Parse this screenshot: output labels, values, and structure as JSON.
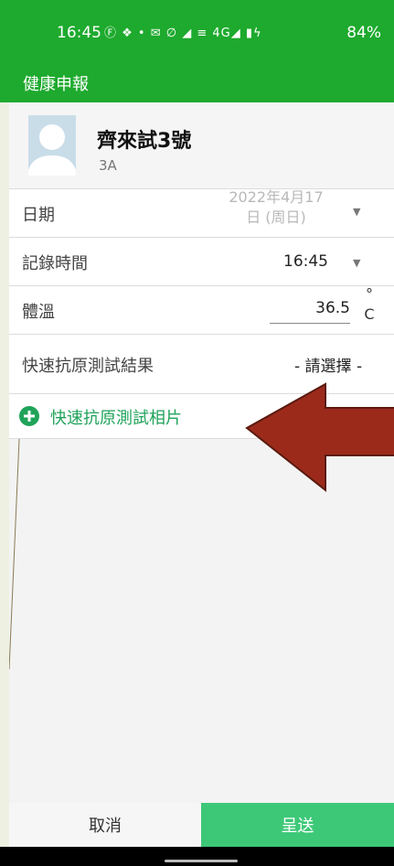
{
  "status_bar": {
    "time": "16:45",
    "icons": "Ⓕ ❖ •  ✉ ∅ ◢ ≡ 4G◢ ▮ϟ",
    "battery": "84%"
  },
  "app_bar": {
    "title": "健康申報"
  },
  "profile": {
    "name": "齊來試3號",
    "class": "3A"
  },
  "form": {
    "date": {
      "label": "日期",
      "value_line1": "2022年4月17",
      "value_line2": "日 (周日)"
    },
    "record_time": {
      "label": "記錄時間",
      "value": "16:45"
    },
    "temperature": {
      "label": "體溫",
      "value": "36.5",
      "unit_top": "°",
      "unit_bottom": "C"
    },
    "rat_result": {
      "label": "快速抗原測試結果",
      "value": "- 請選擇 -"
    },
    "rat_photo": {
      "label": "快速抗原測試相片"
    }
  },
  "footer": {
    "cancel_label": "取消",
    "submit_label": "呈送"
  },
  "colors": {
    "header_green": "#1eaa2e",
    "accent_green": "#1fa35a",
    "submit_green": "#3dc878",
    "arrow_red": "#9b2a1b"
  },
  "icons": {
    "photo_add": "plus-circle-icon",
    "dropdown": "caret-down-icon",
    "annotation": "left-arrow-annotation"
  }
}
